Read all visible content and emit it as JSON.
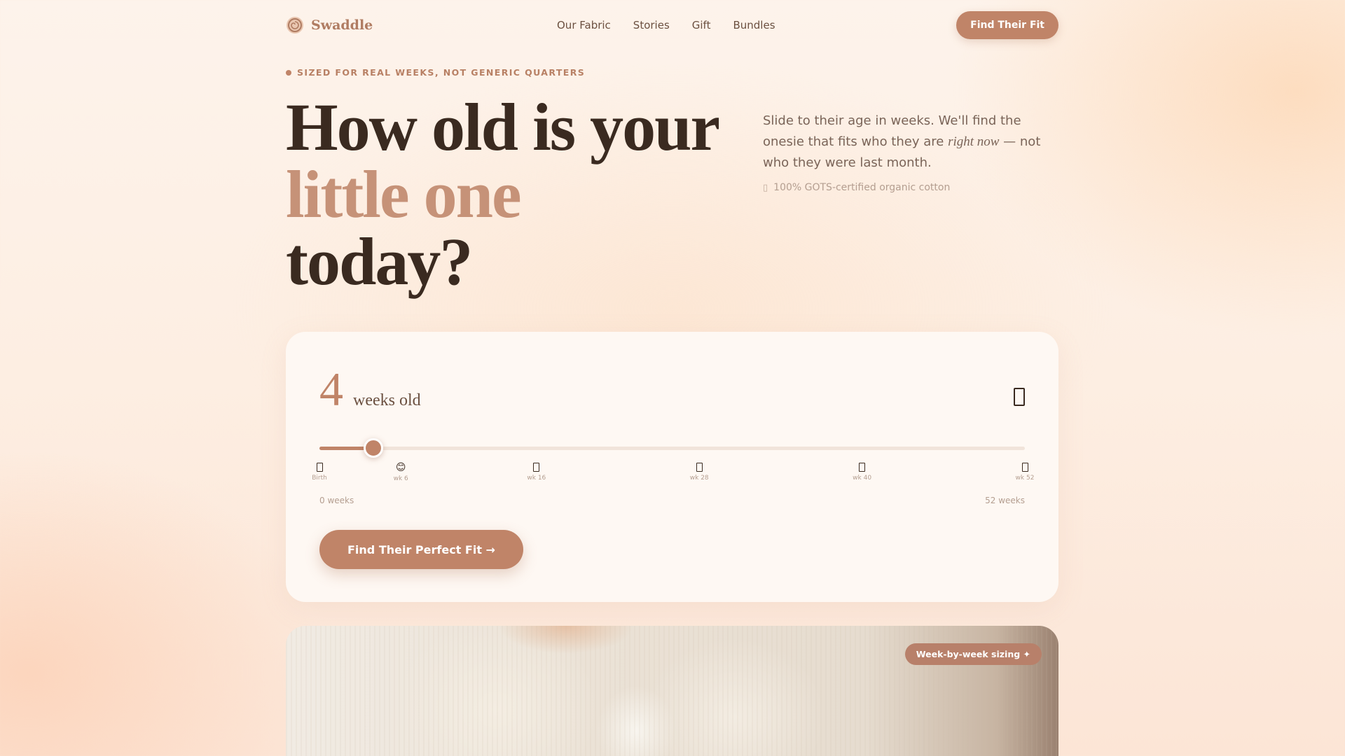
{
  "brand": {
    "name": "Swaddle",
    "logo_icon": "spiral-logo-icon"
  },
  "nav": {
    "links": [
      "Our Fabric",
      "Stories",
      "Gift",
      "Bundles"
    ],
    "cta_label": "Find Their Fit"
  },
  "hero": {
    "eyebrow": "SIZED FOR REAL WEEKS, NOT GENERIC QUARTERS",
    "headline_line1": "How old is your",
    "headline_line2": "little one",
    "headline_line3": "today?",
    "intro_before": "Slide to their age in weeks. We'll find the onesie that fits who they are",
    "intro_emphasis": "right now",
    "intro_after": "— not who they were last month.",
    "certification": "100% GOTS-certified organic cotton",
    "certification_icon": "leaf-icon"
  },
  "age_picker": {
    "value": 4,
    "unit_label": "weeks old",
    "min": 0,
    "max": 52,
    "min_label": "0 weeks",
    "max_label": "52 weeks",
    "stage_icon": "baby-icon",
    "milestones": [
      {
        "week": 0,
        "label": "Birth",
        "icon": "newborn-icon"
      },
      {
        "week": 6,
        "label": "wk 6",
        "icon": "smile-emoji",
        "glyph": "😊"
      },
      {
        "week": 16,
        "label": "wk 16",
        "icon": "baby-icon"
      },
      {
        "week": 28,
        "label": "wk 28",
        "icon": "baby-icon"
      },
      {
        "week": 40,
        "label": "wk 40",
        "icon": "baby-icon"
      },
      {
        "week": 52,
        "label": "wk 52",
        "icon": "baby-icon"
      }
    ],
    "cta_label": "Find Their Perfect Fit →"
  },
  "photo": {
    "badge": "Week-by-week sizing ✦"
  },
  "colors": {
    "accent": "#c08468",
    "text_dark": "#3a2a20",
    "headline_accent": "#c69278"
  }
}
